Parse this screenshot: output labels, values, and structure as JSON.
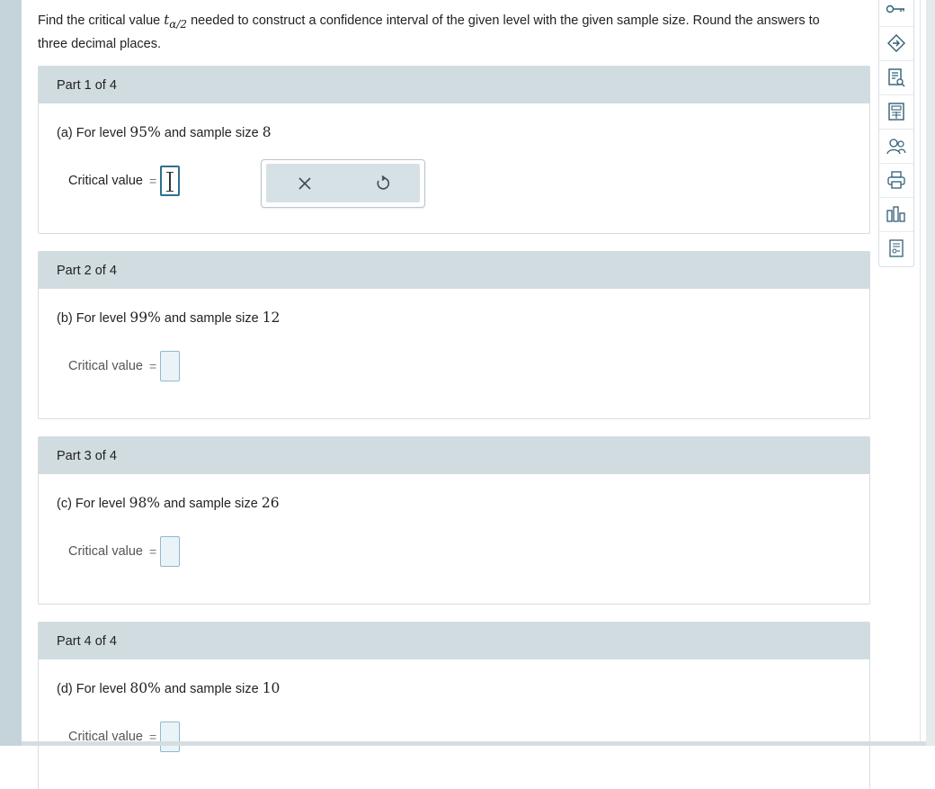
{
  "question": {
    "before": "Find the critical value",
    "t_symbol": "t",
    "t_subscript": "α/2",
    "after": "needed to construct a confidence interval of the given level with the given sample size. Round the answers to three decimal places."
  },
  "parts": [
    {
      "header": "Part 1 of 4",
      "letter": "(a) For level",
      "level": "95%",
      "mid": "and sample size",
      "n": "8",
      "label": "Critical value",
      "eq": "="
    },
    {
      "header": "Part 2 of 4",
      "letter": "(b) For level",
      "level": "99%",
      "mid": "and sample size",
      "n": "12",
      "label": "Critical value",
      "eq": "="
    },
    {
      "header": "Part 3 of 4",
      "letter": "(c) For level",
      "level": "98%",
      "mid": "and sample size",
      "n": "26",
      "label": "Critical value",
      "eq": "="
    },
    {
      "header": "Part 4 of 4",
      "letter": "(d) For level",
      "level": "80%",
      "mid": "and sample size",
      "n": "10",
      "label": "Critical value",
      "eq": "="
    }
  ],
  "toolpad": {
    "clear": "×",
    "undo": "↺"
  },
  "sidebar": {
    "icons": [
      "key-icon",
      "tag-icon",
      "textbook-icon",
      "calculator-icon",
      "ask-instructor-icon",
      "print-icon",
      "data-chart-icon",
      "worksheet-icon"
    ]
  },
  "colors": {
    "header_bg": "#d1dce1",
    "input_bg": "#eaf4f8",
    "input_border": "#8fb9cc",
    "active_border": "#2f6f8f",
    "icon": "#2f5f75"
  }
}
